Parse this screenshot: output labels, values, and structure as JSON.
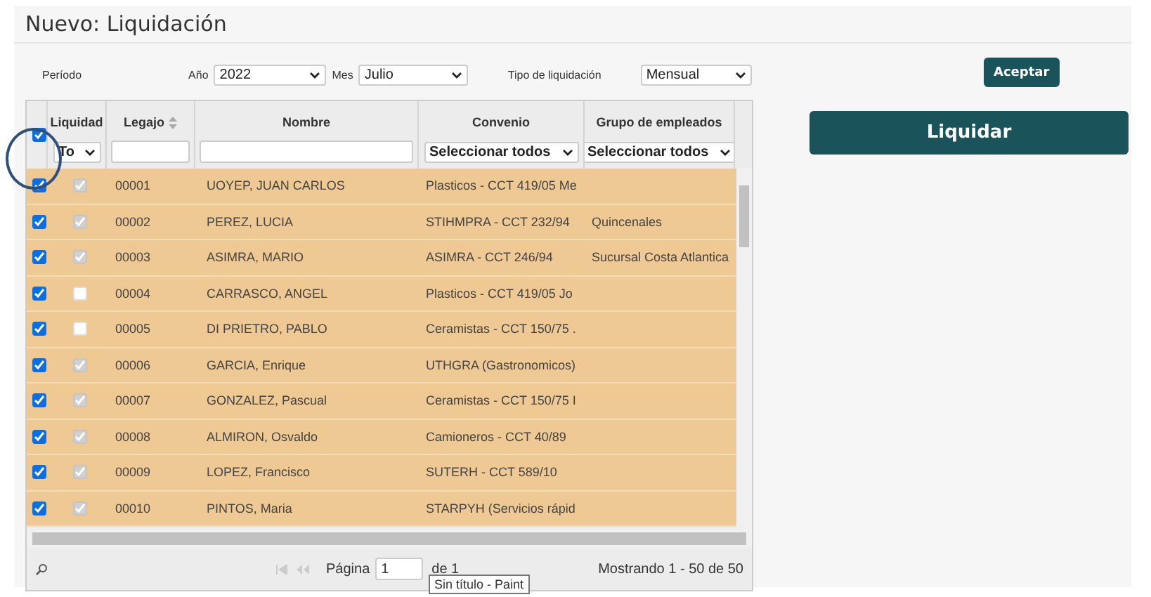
{
  "title": "Nuevo: Liquidación",
  "filters": [
    {
      "label": "Período"
    },
    {
      "label": "Año",
      "value": "2022"
    },
    {
      "label": "Mes",
      "value": "Julio"
    },
    {
      "label": "Tipo de liquidación",
      "value": "Mensual"
    }
  ],
  "accept_button": "Aceptar",
  "liquidar_button": "Liquidar",
  "table": {
    "select_all_checked": true,
    "columns": [
      {
        "label": "Liquidad",
        "filter": "To"
      },
      {
        "label": "Legajo",
        "sortable": true
      },
      {
        "label": "Nombre"
      },
      {
        "label": "Convenio",
        "filter": "Seleccionar todos"
      },
      {
        "label": "Grupo de empleados",
        "filter": "Seleccionar todos"
      }
    ],
    "rows": [
      {
        "checked": true,
        "liquidar": true,
        "legajo": "00001",
        "nombre": "UOYEP, JUAN CARLOS",
        "convenio": "Plasticos - CCT 419/05 Me",
        "grupo": ""
      },
      {
        "checked": true,
        "liquidar": true,
        "legajo": "00002",
        "nombre": "PEREZ, LUCIA",
        "convenio": "STIHMPRA - CCT 232/94",
        "grupo": "Quincenales"
      },
      {
        "checked": true,
        "liquidar": true,
        "legajo": "00003",
        "nombre": "ASIMRA, MARIO",
        "convenio": "ASIMRA - CCT 246/94",
        "grupo": "Sucursal Costa Atlantica"
      },
      {
        "checked": true,
        "liquidar": false,
        "legajo": "00004",
        "nombre": "CARRASCO, ANGEL",
        "convenio": "Plasticos - CCT 419/05 Jo",
        "grupo": ""
      },
      {
        "checked": true,
        "liquidar": false,
        "legajo": "00005",
        "nombre": "DI PRIETRO, PABLO",
        "convenio": "Ceramistas - CCT 150/75 .",
        "grupo": ""
      },
      {
        "checked": true,
        "liquidar": true,
        "legajo": "00006",
        "nombre": "GARCIA, Enrique",
        "convenio": "UTHGRA (Gastronomicos)",
        "grupo": ""
      },
      {
        "checked": true,
        "liquidar": true,
        "legajo": "00007",
        "nombre": "GONZALEZ, Pascual",
        "convenio": "Ceramistas - CCT 150/75 I",
        "grupo": ""
      },
      {
        "checked": true,
        "liquidar": true,
        "legajo": "00008",
        "nombre": "ALMIRON, Osvaldo",
        "convenio": "Camioneros - CCT 40/89",
        "grupo": ""
      },
      {
        "checked": true,
        "liquidar": true,
        "legajo": "00009",
        "nombre": "LOPEZ, Francisco",
        "convenio": "SUTERH - CCT 589/10",
        "grupo": ""
      },
      {
        "checked": true,
        "liquidar": true,
        "legajo": "00010",
        "nombre": "PINTOS, Maria",
        "convenio": "STARPYH (Servicios rápid",
        "grupo": ""
      }
    ]
  },
  "pager": {
    "page_label": "Página",
    "page": "1",
    "of": "de 1",
    "summary": "Mostrando 1 - 50 de 50"
  },
  "tooltip": "Sin título - Paint"
}
